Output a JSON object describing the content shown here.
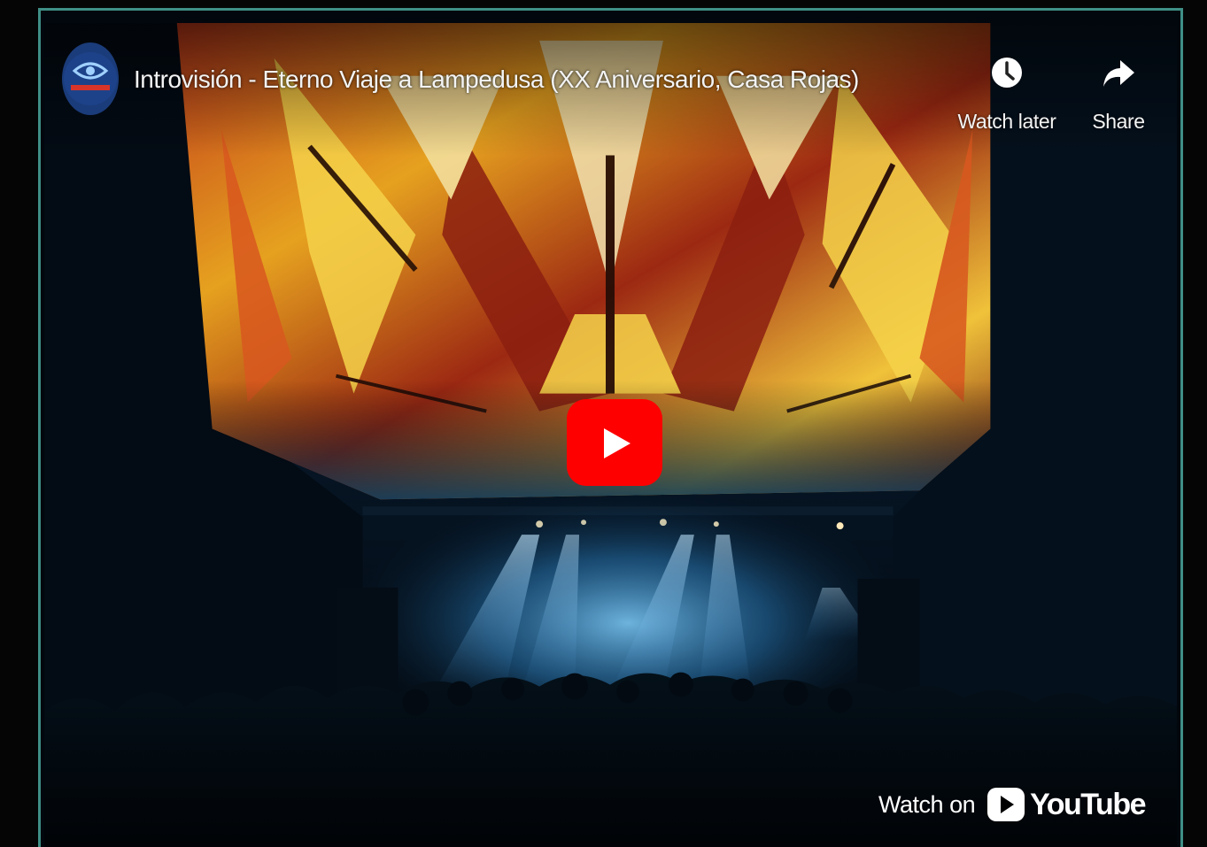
{
  "video": {
    "title": "Introvisión - Eterno Viaje a Lampedusa (XX Aniversario, Casa Rojas)",
    "channel_avatar_icon": "eye-logo-icon"
  },
  "actions": {
    "watch_later": {
      "label": "Watch later",
      "icon": "clock-icon"
    },
    "share": {
      "label": "Share",
      "icon": "share-arrow-icon"
    }
  },
  "player": {
    "play_icon": "play-icon",
    "play_color": "#ff0000"
  },
  "watch_on": {
    "prefix": "Watch on",
    "brand": "YouTube",
    "icon": "youtube-logo-icon"
  },
  "colors": {
    "frame_border": "#3f8f86",
    "background": "#050505"
  }
}
